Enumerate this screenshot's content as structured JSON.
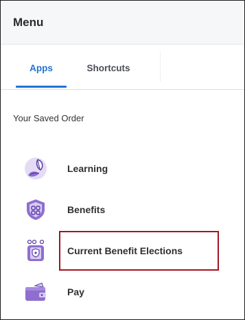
{
  "menu": {
    "title": "Menu"
  },
  "tabs": [
    {
      "label": "Apps",
      "active": true
    },
    {
      "label": "Shortcuts",
      "active": false
    }
  ],
  "section": {
    "label": "Your Saved Order"
  },
  "apps": [
    {
      "label": "Learning",
      "icon": "learning-icon"
    },
    {
      "label": "Benefits",
      "icon": "benefits-shield-icon"
    },
    {
      "label": "Current Benefit Elections",
      "icon": "benefit-elections-icon",
      "highlighted": true
    },
    {
      "label": "Pay",
      "icon": "wallet-icon"
    }
  ],
  "colors": {
    "accent": "#1f73d6",
    "icon_purple": "#8e6fd1",
    "icon_light": "#d9ccf2",
    "highlight_border": "#a3121f"
  }
}
